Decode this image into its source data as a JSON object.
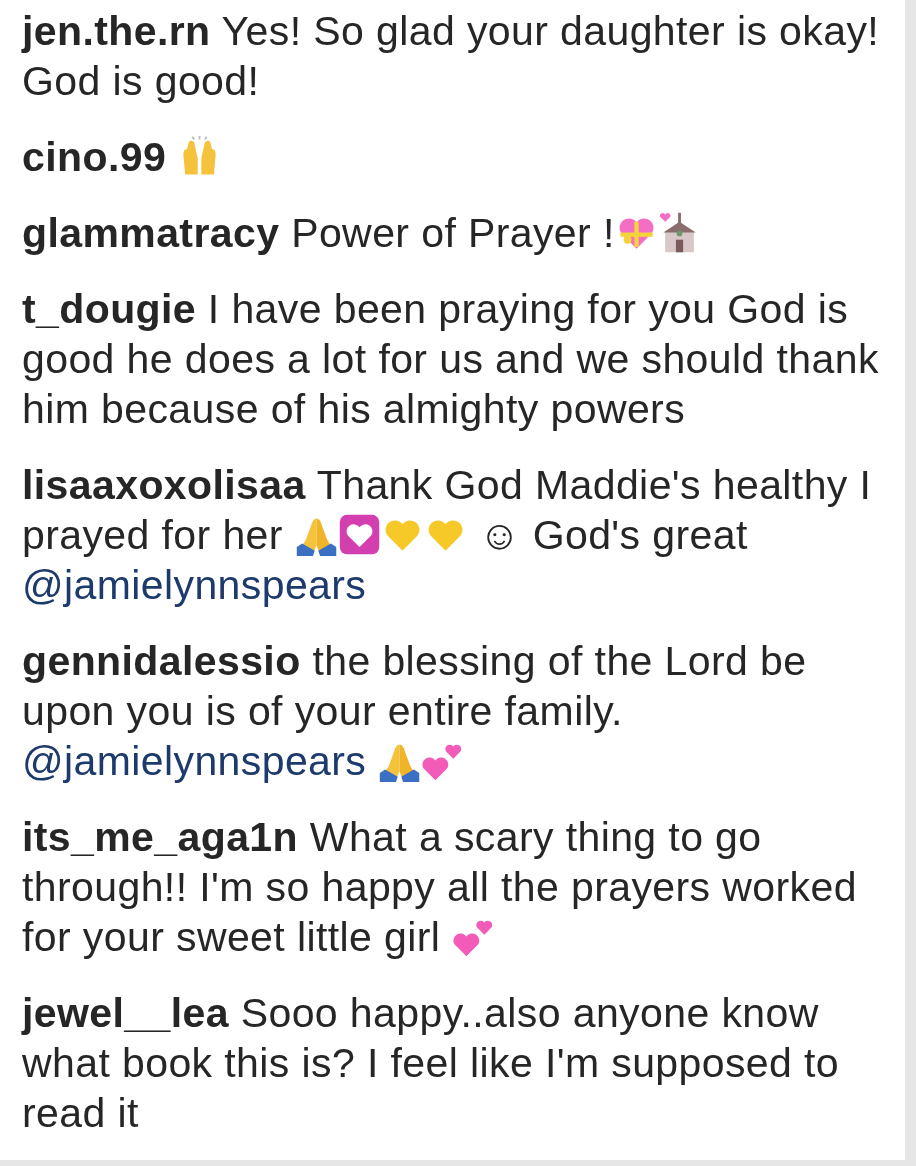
{
  "comments": [
    {
      "username": "jen.the.rn",
      "parts": [
        {
          "kind": "text",
          "text": "Yes! So glad your daughter is okay! God is good!"
        }
      ]
    },
    {
      "username": "cino.99",
      "parts": [
        {
          "kind": "hands"
        }
      ]
    },
    {
      "username": "glammatracy",
      "parts": [
        {
          "kind": "text",
          "text": "Power of Prayer !"
        },
        {
          "kind": "giftheart"
        },
        {
          "kind": "chapel"
        }
      ]
    },
    {
      "username": "t_dougie",
      "parts": [
        {
          "kind": "text",
          "text": "I have been praying for you God is good he does a lot for us and we should thank him because of his almighty powers"
        }
      ]
    },
    {
      "username": "lisaaxoxolisaa",
      "parts": [
        {
          "kind": "text",
          "text": "Thank God Maddie's healthy I prayed for her "
        },
        {
          "kind": "pray"
        },
        {
          "kind": "heartbox"
        },
        {
          "kind": "yellowheart"
        },
        {
          "kind": "yellowheart"
        },
        {
          "kind": "text",
          "text": " ☺ God's great "
        },
        {
          "kind": "mention",
          "text": "@jamielynnspears"
        }
      ]
    },
    {
      "username": "gennidalessio",
      "parts": [
        {
          "kind": "text",
          "text": "the blessing of the Lord be upon you is of your entire family. "
        },
        {
          "kind": "mention",
          "text": "@jamielynnspears"
        },
        {
          "kind": "pray"
        },
        {
          "kind": "twohearts"
        }
      ]
    },
    {
      "username": "its_me_aga1n",
      "parts": [
        {
          "kind": "text",
          "text": "What a scary thing to go through!! I'm so happy all the prayers worked for your sweet little girl "
        },
        {
          "kind": "twohearts"
        }
      ]
    },
    {
      "username": "jewel__lea",
      "parts": [
        {
          "kind": "text",
          "text": "Sooo happy..also anyone know what book this is? I feel like I'm supposed to read it"
        }
      ]
    }
  ]
}
